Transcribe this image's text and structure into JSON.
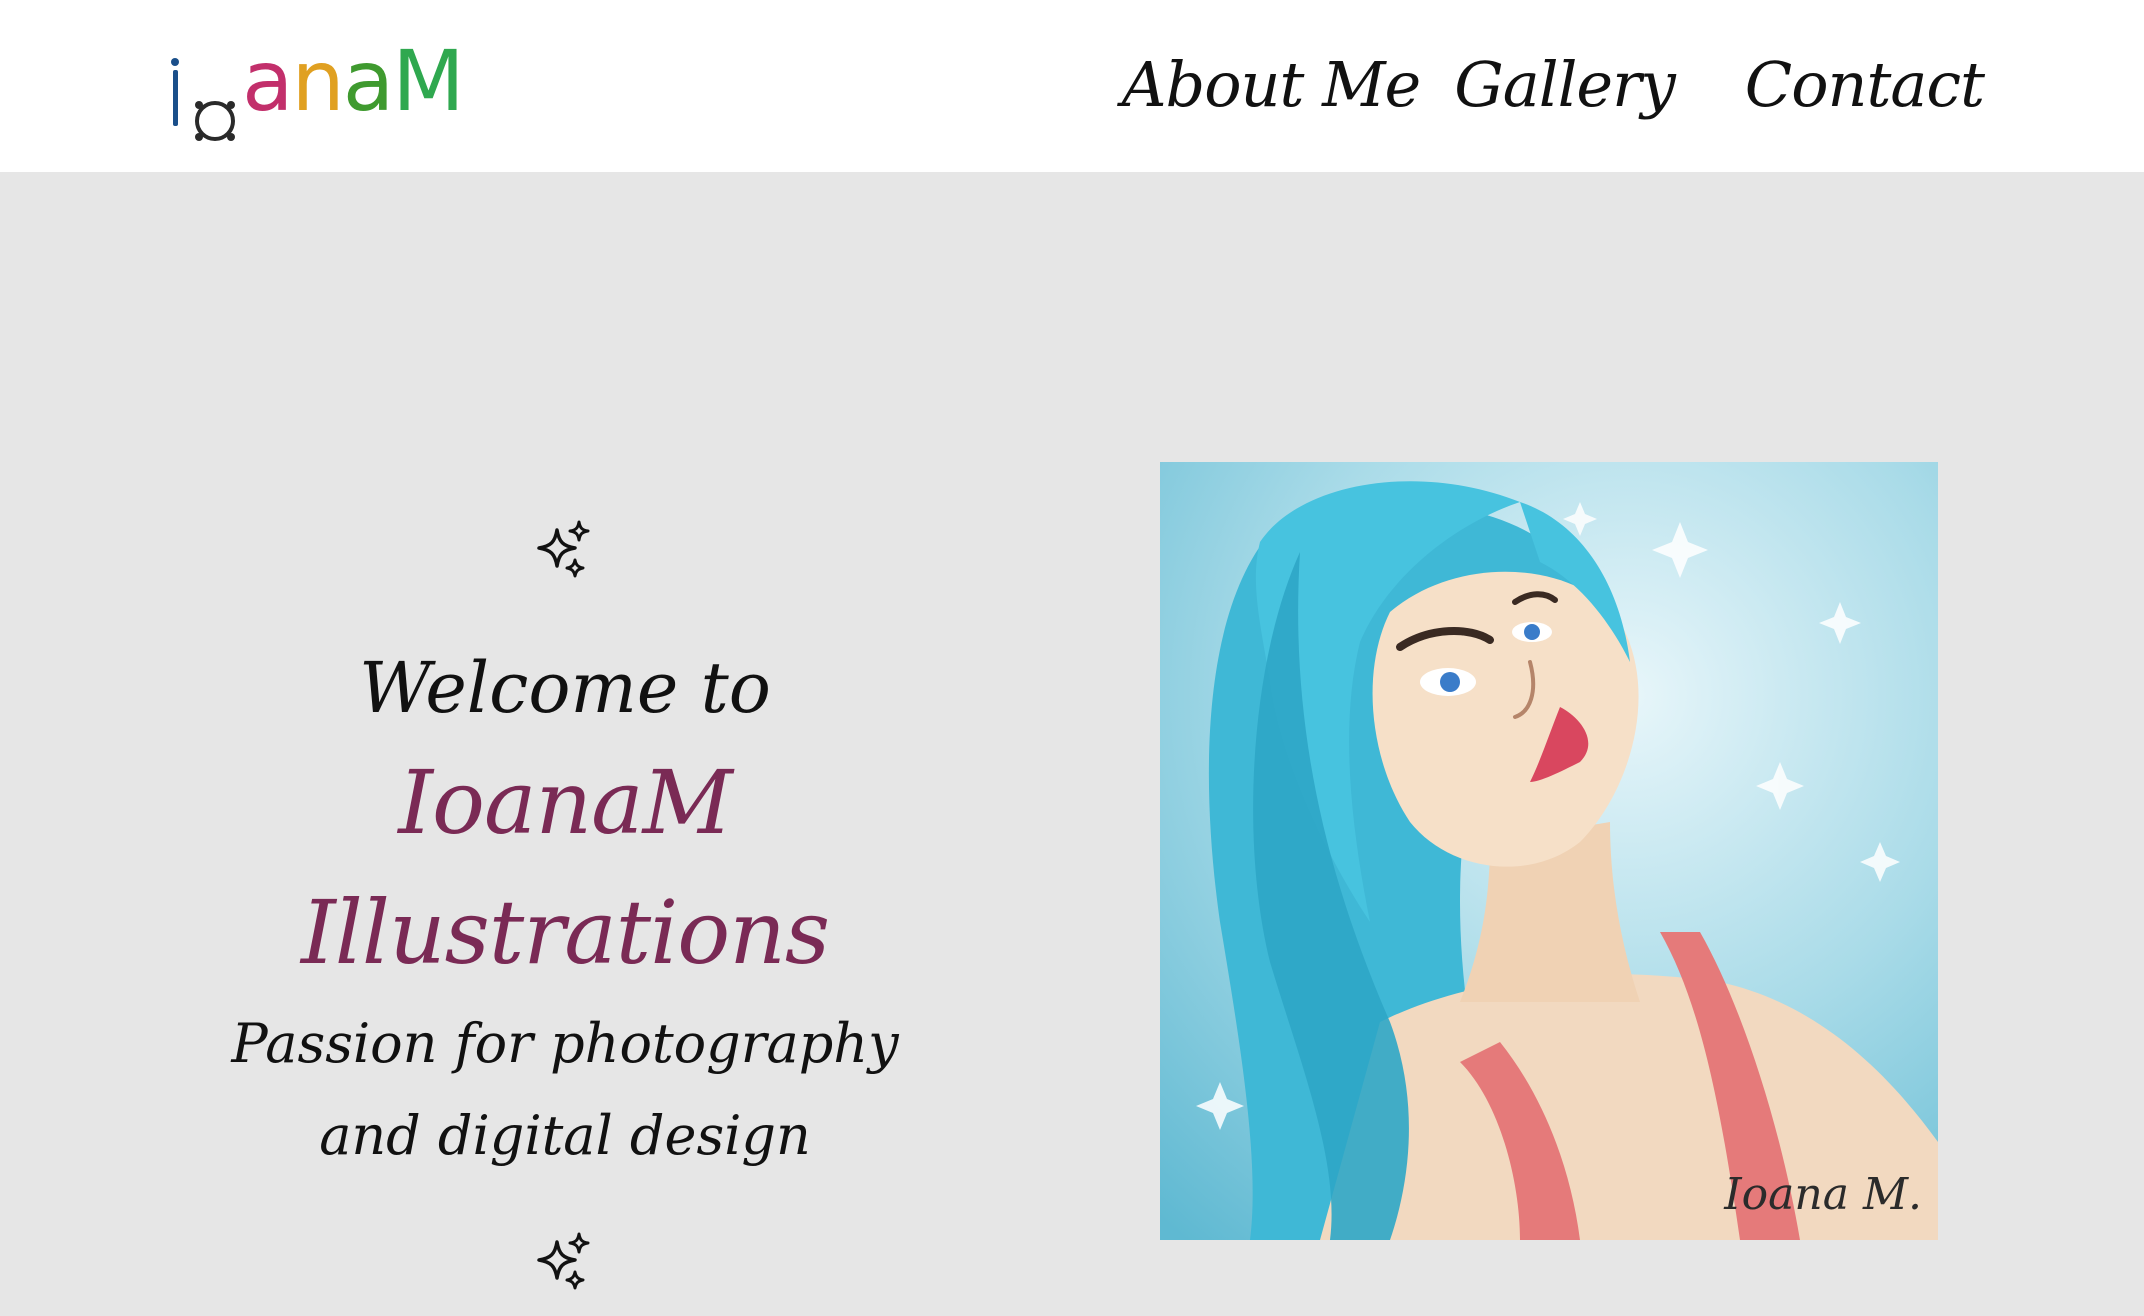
{
  "header": {
    "logo_text": "IoanaM",
    "logo_colors": [
      "#1a4f8a",
      "#2a2a2a",
      "#c22f6b",
      "#e0a021",
      "#3f9a2f",
      "#2fa84f"
    ],
    "nav": [
      {
        "label": "About Me"
      },
      {
        "label": "Gallery"
      },
      {
        "label": "Contact"
      }
    ]
  },
  "hero": {
    "welcome": "Welcome to",
    "brand": "IoanaM Illustrations",
    "tagline_line1": "Passion for photography",
    "tagline_line2": "and digital design",
    "sparkle_icon": "sparkle-icon"
  },
  "artwork": {
    "signature": "Ioana M.",
    "background_color": "#bfe3ec",
    "hair_color": "#3fb8d6"
  },
  "colors": {
    "page_bg": "#e6e6e6",
    "header_bg": "#ffffff",
    "brand_accent": "#7a2a55"
  }
}
